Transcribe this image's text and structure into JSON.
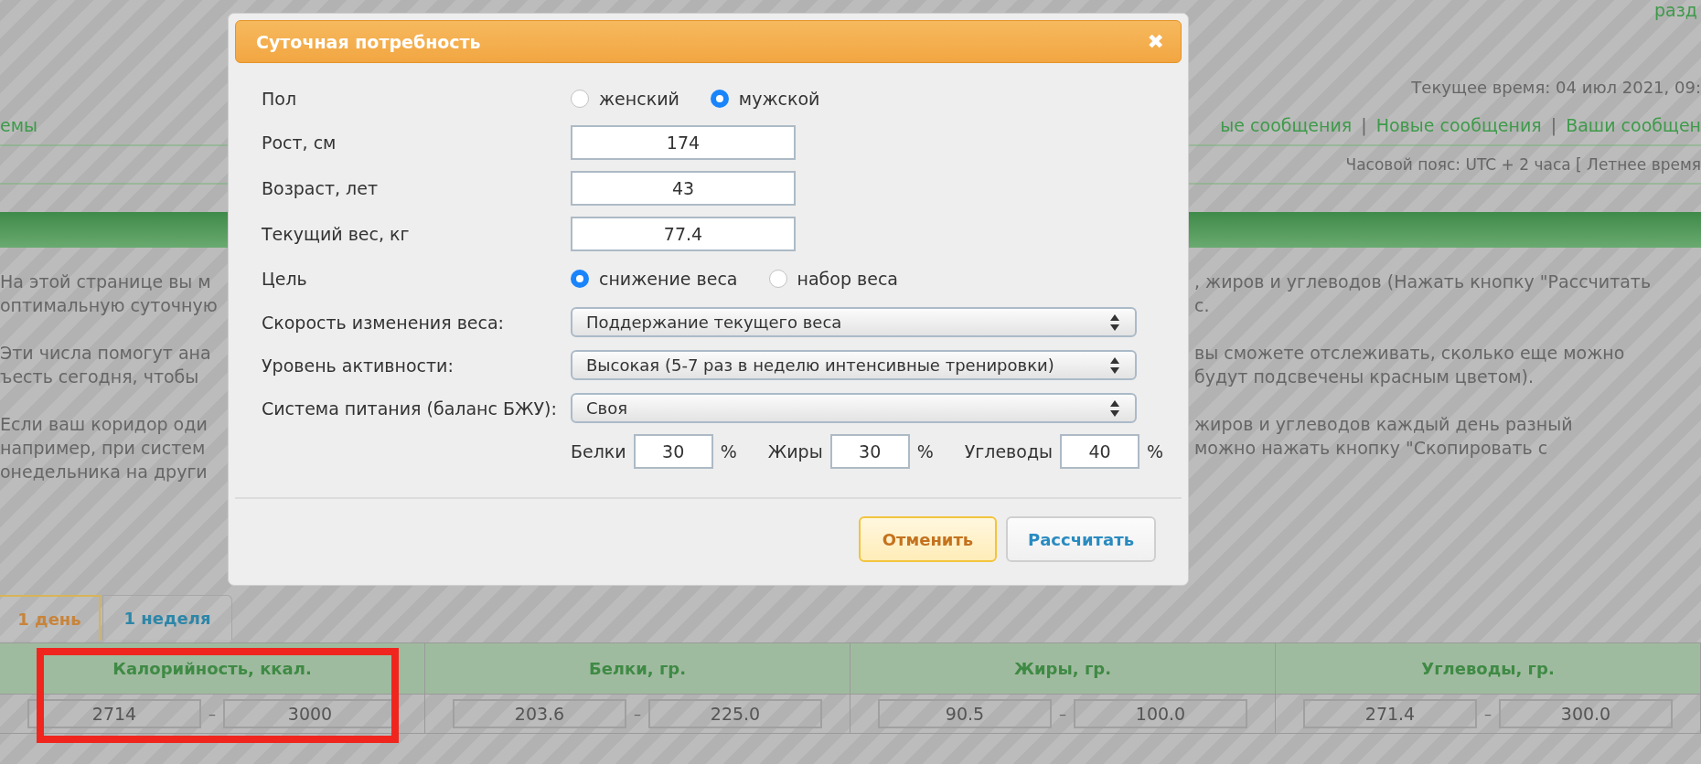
{
  "header": {
    "top_link": "разд",
    "current_time": "Текущее время: 04 июл 2021, 09:",
    "nav_left": "емы",
    "nav_items": [
      {
        "kind": "link",
        "label": "ые сообщения"
      },
      {
        "kind": "separator",
        "label": "|"
      },
      {
        "kind": "link",
        "label": "Новые сообщения"
      },
      {
        "kind": "separator",
        "label": "|"
      },
      {
        "kind": "link",
        "label": "Ваши сообщен"
      }
    ],
    "timezone": "Часовой пояс: UTC + 2 часа [ Летнее время"
  },
  "intro": [
    [
      {
        "left": "На этой странице вы м",
        "right": ", жиров и углеводов (Нажать кнопку \"Рассчитать"
      },
      {
        "left": "оптимальную суточную",
        "right": "с."
      }
    ],
    [
      {
        "left": "Эти числа помогут ана",
        "right": "вы сможете отслеживать, сколько еще можно"
      },
      {
        "left": "ъесть сегодня, чтобы",
        "right": "будут подсвечены красным цветом)."
      }
    ],
    [
      {
        "left": "Если ваш коридор оди",
        "right": "жиров и углеводов каждый день разный"
      },
      {
        "left": "например, при систем",
        "right": "можно нажать кнопку \"Скопировать с"
      },
      {
        "left": "онедельника на други"
      }
    ]
  ],
  "tabs": [
    {
      "label": "1 день",
      "selected": true
    },
    {
      "label": "1 неделя",
      "selected": false
    }
  ],
  "table": {
    "columns": [
      {
        "title": "Калорийность, ккал.",
        "min": "2714",
        "dash": "–",
        "max": "3000"
      },
      {
        "title": "Белки, гр.",
        "min": "203.6",
        "dash": "–",
        "max": "225.0"
      },
      {
        "title": "Жиры, гр.",
        "min": "90.5",
        "dash": "–",
        "max": "100.0"
      },
      {
        "title": "Углеводы, гр.",
        "min": "271.4",
        "dash": "–",
        "max": "300.0"
      }
    ]
  },
  "dialog": {
    "title": "Суточная потребность",
    "close": "✖",
    "rows": [
      {
        "kind": "radio",
        "label": "Пол",
        "options": [
          {
            "label": "женский",
            "selected": false
          },
          {
            "label": "мужской",
            "selected": true
          }
        ]
      },
      {
        "kind": "input",
        "label": "Рост, см",
        "value": "174"
      },
      {
        "kind": "input",
        "label": "Возраст, лет",
        "value": "43"
      },
      {
        "kind": "input",
        "label": "Текущий вес, кг",
        "value": "77.4"
      },
      {
        "kind": "radio",
        "label": "Цель",
        "options": [
          {
            "label": "снижение веса",
            "selected": true
          },
          {
            "label": "набор веса",
            "selected": false
          }
        ]
      },
      {
        "kind": "select",
        "label": "Скорость изменения веса:",
        "value": "Поддержание текущего веса"
      },
      {
        "kind": "select",
        "label": "Уровень активности:",
        "value": "Высокая (5-7 раз в неделю интенсивные тренировки)"
      },
      {
        "kind": "select",
        "label": "Система питания (баланс БЖУ):",
        "value": "Своя"
      },
      {
        "kind": "macros",
        "items": [
          {
            "label": "Белки",
            "value": "30",
            "unit": "%"
          },
          {
            "label": "Жиры",
            "value": "30",
            "unit": "%"
          },
          {
            "label": "Углеводы",
            "value": "40",
            "unit": "%"
          }
        ]
      }
    ],
    "buttons": [
      {
        "kind": "cancel",
        "label": "Отменить"
      },
      {
        "kind": "primary",
        "label": "Рассчитать"
      }
    ]
  }
}
